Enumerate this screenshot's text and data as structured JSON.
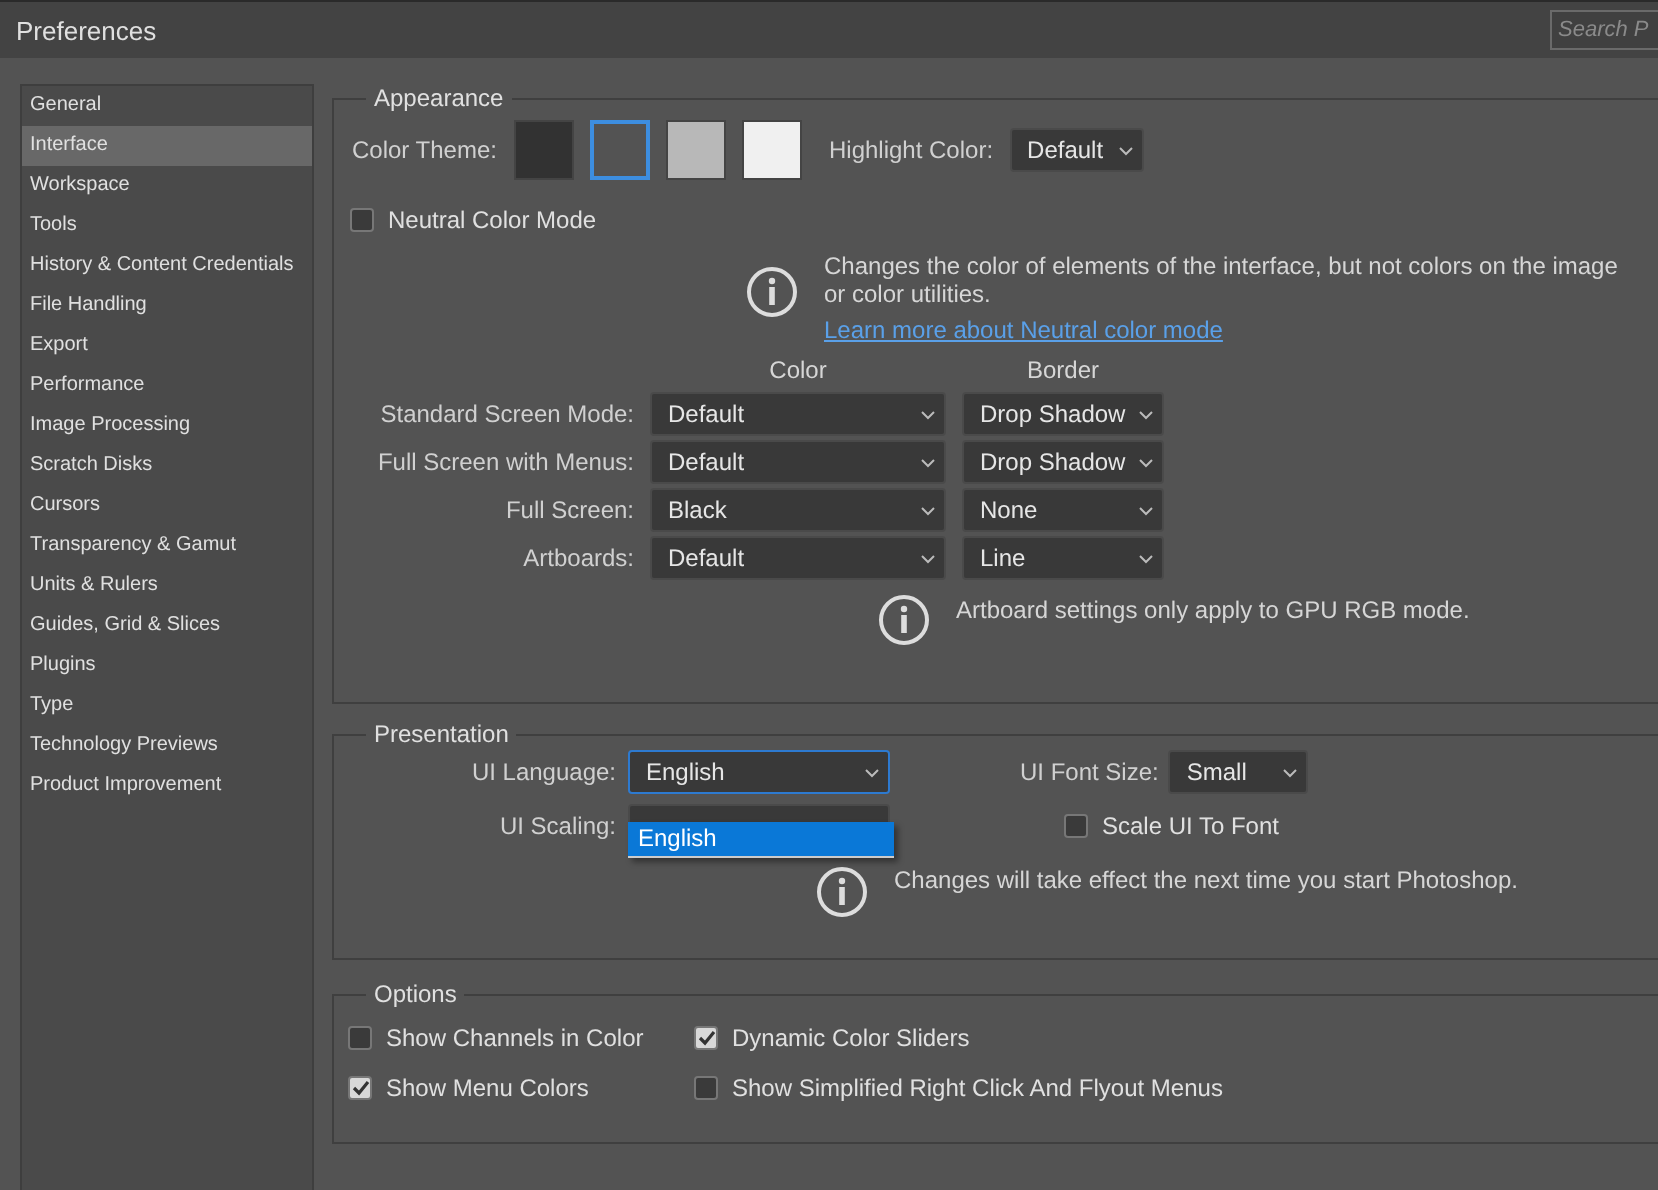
{
  "window": {
    "title": "Preferences",
    "search": {
      "placeholder": "Search P"
    }
  },
  "sidebar": {
    "items": [
      {
        "label": "General",
        "selected": false
      },
      {
        "label": "Interface",
        "selected": true
      },
      {
        "label": "Workspace",
        "selected": false
      },
      {
        "label": "Tools",
        "selected": false
      },
      {
        "label": "History & Content Credentials",
        "selected": false
      },
      {
        "label": "File Handling",
        "selected": false
      },
      {
        "label": "Export",
        "selected": false
      },
      {
        "label": "Performance",
        "selected": false
      },
      {
        "label": "Image Processing",
        "selected": false
      },
      {
        "label": "Scratch Disks",
        "selected": false
      },
      {
        "label": "Cursors",
        "selected": false
      },
      {
        "label": "Transparency & Gamut",
        "selected": false
      },
      {
        "label": "Units & Rulers",
        "selected": false
      },
      {
        "label": "Guides, Grid & Slices",
        "selected": false
      },
      {
        "label": "Plugins",
        "selected": false
      },
      {
        "label": "Type",
        "selected": false
      },
      {
        "label": "Technology Previews",
        "selected": false
      },
      {
        "label": "Product Improvement",
        "selected": false
      }
    ]
  },
  "appearance": {
    "title": "Appearance",
    "color_theme_label": "Color Theme:",
    "themes": [
      {
        "color": "#323232",
        "selected": false
      },
      {
        "color": "#535353",
        "selected": true
      },
      {
        "color": "#b8b8b8",
        "selected": false
      },
      {
        "color": "#f0f0f0",
        "selected": false
      }
    ],
    "highlight_label": "Highlight Color:",
    "highlight_value": "Default",
    "neutral_mode": {
      "label": "Neutral Color Mode",
      "checked": false
    },
    "info": "Changes the color of elements of the interface, but not colors on the image or color utilities.",
    "link": "Learn more about Neutral color mode",
    "columns": [
      "Color",
      "Border"
    ],
    "rows": [
      {
        "label": "Standard Screen Mode:",
        "color_value": "Default",
        "border_value": "Drop Shadow"
      },
      {
        "label": "Full Screen with Menus:",
        "color_value": "Default",
        "border_value": "Drop Shadow"
      },
      {
        "label": "Full Screen:",
        "color_value": "Black",
        "border_value": "None"
      },
      {
        "label": "Artboards:",
        "color_value": "Default",
        "border_value": "Line"
      }
    ],
    "artboard_note": "Artboard settings only apply to GPU RGB mode."
  },
  "presentation": {
    "title": "Presentation",
    "language_label": "UI Language:",
    "language_value": "English",
    "language_options": [
      {
        "label": "English",
        "selected": true
      }
    ],
    "scaling_label": "UI Scaling:",
    "font_size_label": "UI Font Size:",
    "font_size_value": "Small",
    "scale_to_font": {
      "label": "Scale UI To Font",
      "checked": false
    },
    "note": "Changes will take effect the next time you start Photoshop."
  },
  "options": {
    "title": "Options",
    "items": [
      {
        "label": "Show Channels in Color",
        "checked": false
      },
      {
        "label": "Dynamic Color Sliders",
        "checked": true
      },
      {
        "label": "Show Menu Colors",
        "checked": true
      },
      {
        "label": "Show Simplified Right Click And Flyout Menus",
        "checked": false
      }
    ]
  }
}
